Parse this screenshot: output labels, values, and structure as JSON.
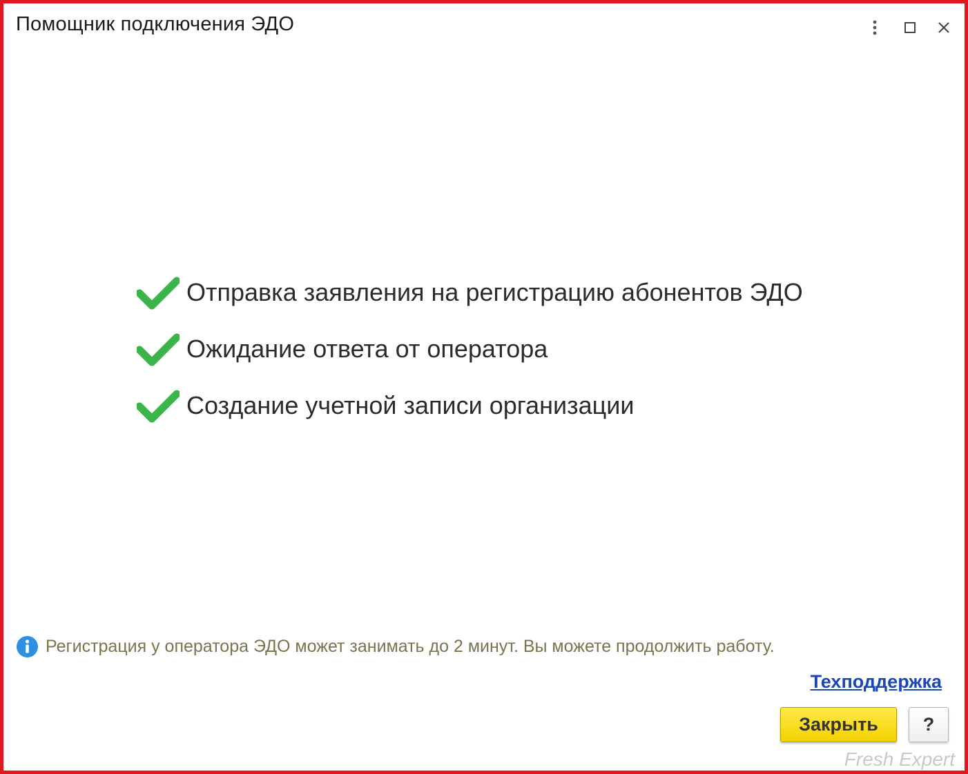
{
  "window": {
    "title": "Помощник подключения ЭДО"
  },
  "title_bar": {
    "icons": [
      "more-vertical-icon",
      "maximize-icon",
      "close-icon"
    ]
  },
  "steps": [
    {
      "label": "Отправка заявления на регистрацию абонентов ЭДО",
      "status": "done",
      "icon": "checkmark-icon"
    },
    {
      "label": "Ожидание ответа от оператора",
      "status": "done",
      "icon": "checkmark-icon"
    },
    {
      "label": "Создание учетной записи организации",
      "status": "done",
      "icon": "checkmark-icon"
    }
  ],
  "info": {
    "icon": "info-icon",
    "text": "Регистрация у оператора ЭДО может занимать до 2 минут. Вы можете продолжить работу."
  },
  "support_link": "Техподдержка",
  "buttons": {
    "close_label": "Закрыть",
    "help_label": "?"
  },
  "watermark": "Fresh Expert",
  "colors": {
    "border": "#e0181f",
    "check_green": "#3bb54a",
    "primary_button": "#f2d300",
    "link": "#1b47b4",
    "info_text": "#7a7350",
    "info_icon": "#2f8ee0"
  }
}
